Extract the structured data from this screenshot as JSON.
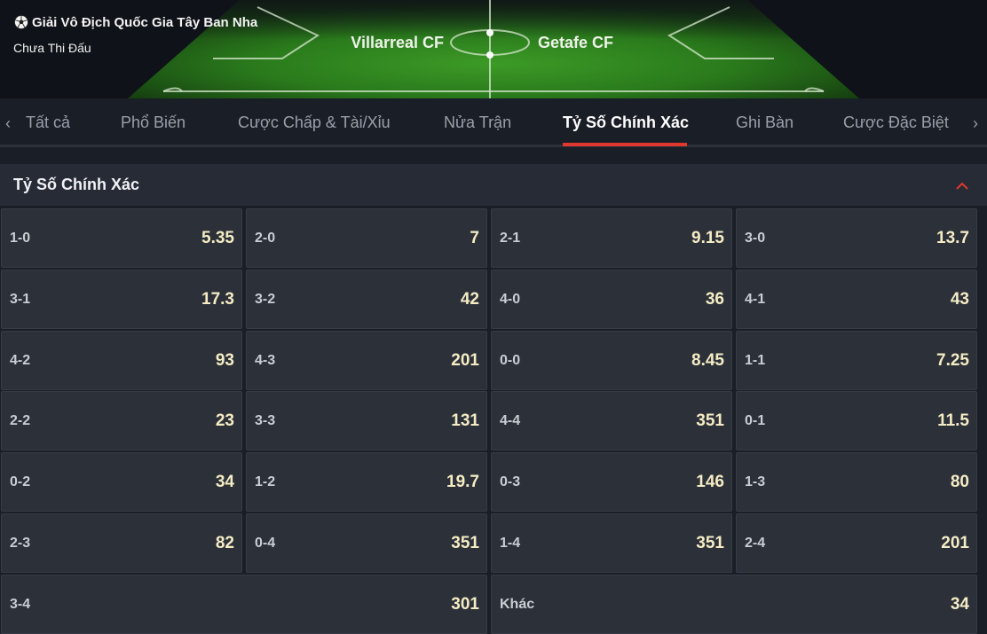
{
  "header": {
    "league": "Giải Vô Địch Quốc Gia Tây Ban Nha",
    "status": "Chưa Thi Đấu",
    "home_team": "Villarreal CF",
    "away_team": "Getafe CF",
    "league_icon": "soccer-ball-icon"
  },
  "tabs": [
    {
      "label": "Tất cả"
    },
    {
      "label": "Phổ Biến"
    },
    {
      "label": "Cược Chấp & Tài/Xỉu"
    },
    {
      "label": "Nửa Trận"
    },
    {
      "label": "Tỷ Số Chính Xác"
    },
    {
      "label": "Ghi Bàn"
    },
    {
      "label": "Cược Đặc Biệt"
    }
  ],
  "active_tab": "Tỷ Số Chính Xác",
  "section": {
    "title": "Tỷ Số Chính Xác",
    "collapse_icon": "chevron-up-icon"
  },
  "scores": [
    {
      "score": "1-0",
      "odds": "5.35"
    },
    {
      "score": "2-0",
      "odds": "7"
    },
    {
      "score": "2-1",
      "odds": "9.15"
    },
    {
      "score": "3-0",
      "odds": "13.7"
    },
    {
      "score": "3-1",
      "odds": "17.3"
    },
    {
      "score": "3-2",
      "odds": "42"
    },
    {
      "score": "4-0",
      "odds": "36"
    },
    {
      "score": "4-1",
      "odds": "43"
    },
    {
      "score": "4-2",
      "odds": "93"
    },
    {
      "score": "4-3",
      "odds": "201"
    },
    {
      "score": "0-0",
      "odds": "8.45"
    },
    {
      "score": "1-1",
      "odds": "7.25"
    },
    {
      "score": "2-2",
      "odds": "23"
    },
    {
      "score": "3-3",
      "odds": "131"
    },
    {
      "score": "4-4",
      "odds": "351"
    },
    {
      "score": "0-1",
      "odds": "11.5"
    },
    {
      "score": "0-2",
      "odds": "34"
    },
    {
      "score": "1-2",
      "odds": "19.7"
    },
    {
      "score": "0-3",
      "odds": "146"
    },
    {
      "score": "1-3",
      "odds": "80"
    },
    {
      "score": "2-3",
      "odds": "82"
    },
    {
      "score": "0-4",
      "odds": "351"
    },
    {
      "score": "1-4",
      "odds": "351"
    },
    {
      "score": "2-4",
      "odds": "201"
    },
    {
      "score": "3-4",
      "odds": "301"
    },
    {
      "score": "Khác",
      "odds": "34"
    }
  ],
  "colors": {
    "accent": "#e0382e",
    "odds": "#f5ecc4",
    "pitch": "#2f8a1f"
  }
}
